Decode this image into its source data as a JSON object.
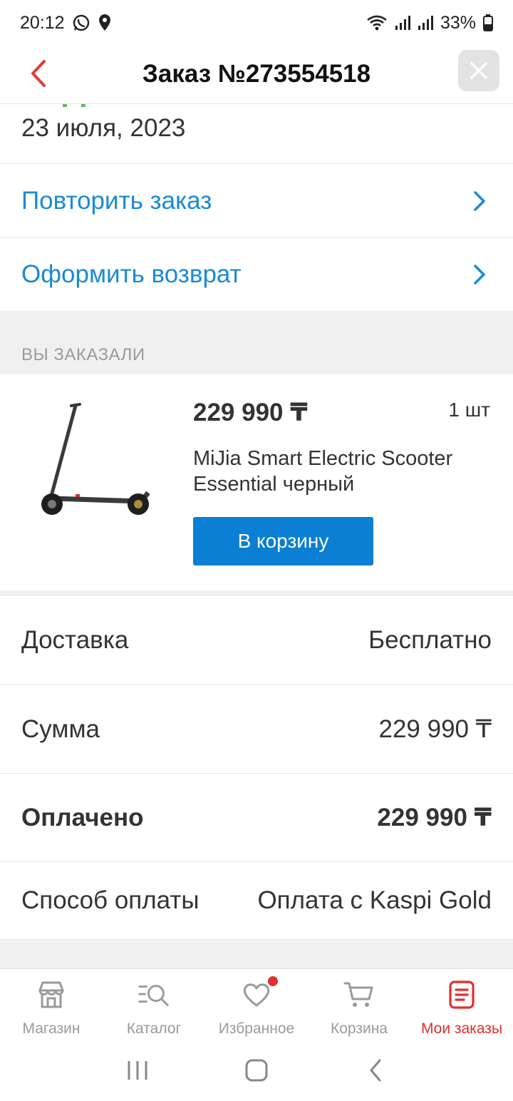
{
  "status_bar": {
    "time": "20:12",
    "battery": "33%"
  },
  "header": {
    "title": "Заказ №273554518"
  },
  "order": {
    "date": "23 июля, 2023"
  },
  "actions": [
    {
      "label": "Повторить заказ"
    },
    {
      "label": "Оформить возврат"
    }
  ],
  "section": {
    "ordered_label": "ВЫ ЗАКАЗАЛИ"
  },
  "product": {
    "price": "229 990 ₸",
    "quantity": "1 шт",
    "name": "MiJia Smart Electric Scooter Essential черный",
    "cart_button": "В корзину"
  },
  "summary": [
    {
      "label": "Доставка",
      "value": "Бесплатно"
    },
    {
      "label": "Сумма",
      "value": "229 990 ₸"
    },
    {
      "label": "Оплачено",
      "value": "229 990 ₸"
    },
    {
      "label": "Способ оплаты",
      "value": "Оплата с Kaspi Gold"
    }
  ],
  "bottom_nav": [
    {
      "label": "Магазин",
      "icon": "store-icon"
    },
    {
      "label": "Каталог",
      "icon": "catalog-search-icon"
    },
    {
      "label": "Избранное",
      "icon": "heart-icon"
    },
    {
      "label": "Корзина",
      "icon": "cart-icon"
    },
    {
      "label": "Мои заказы",
      "icon": "orders-icon"
    }
  ],
  "colors": {
    "accent_red": "#e52d2d",
    "link_blue": "#1a8ad4",
    "button_blue": "#0a7fd3"
  }
}
